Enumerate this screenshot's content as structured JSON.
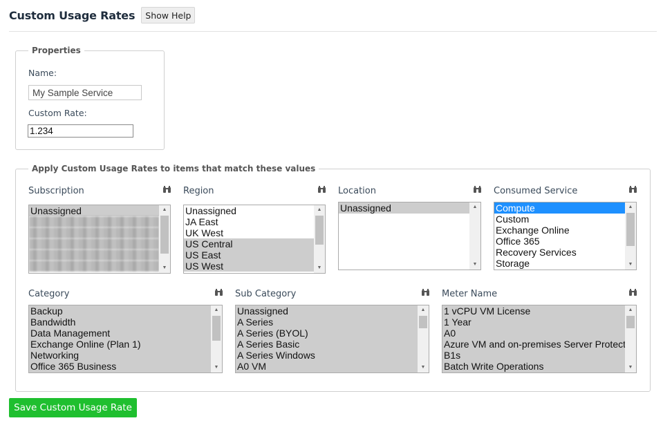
{
  "header": {
    "title": "Custom Usage Rates",
    "help_label": "Show Help"
  },
  "properties": {
    "legend": "Properties",
    "name_label": "Name:",
    "name_value": "My Sample Service",
    "rate_label": "Custom Rate:",
    "rate_value": "1.234"
  },
  "filters": {
    "legend": "Apply Custom Usage Rates to items that match these values",
    "subscription": {
      "label": "Subscription",
      "items": [
        "Unassigned"
      ]
    },
    "region": {
      "label": "Region",
      "items": [
        "Unassigned",
        "JA East",
        "UK West",
        "US Central",
        "US East",
        "US West"
      ]
    },
    "location": {
      "label": "Location",
      "items": [
        "Unassigned"
      ]
    },
    "consumed_service": {
      "label": "Consumed Service",
      "items": [
        "Compute",
        "Custom",
        "Exchange Online",
        "Office 365",
        "Recovery Services",
        "Storage"
      ]
    },
    "category": {
      "label": "Category",
      "items": [
        "Backup",
        "Bandwidth",
        "Data Management",
        "Exchange Online (Plan 1)",
        "Networking",
        "Office 365 Business"
      ]
    },
    "sub_category": {
      "label": "Sub Category",
      "items": [
        "Unassigned",
        "A Series",
        "A Series (BYOL)",
        "A Series Basic",
        "A Series Windows",
        "A0 VM"
      ]
    },
    "meter_name": {
      "label": "Meter Name",
      "items": [
        "1 vCPU VM License",
        "1 Year",
        "A0",
        "Azure VM and on-premises Server Protected Instances",
        "B1s",
        "Batch Write Operations"
      ]
    }
  },
  "save_label": "Save Custom Usage Rate",
  "colors": {
    "accent": "#1fbf2f",
    "selection": "#1e90ff",
    "selected_gray": "#cdcdcd"
  },
  "icons": {
    "search": "binoculars-icon"
  }
}
